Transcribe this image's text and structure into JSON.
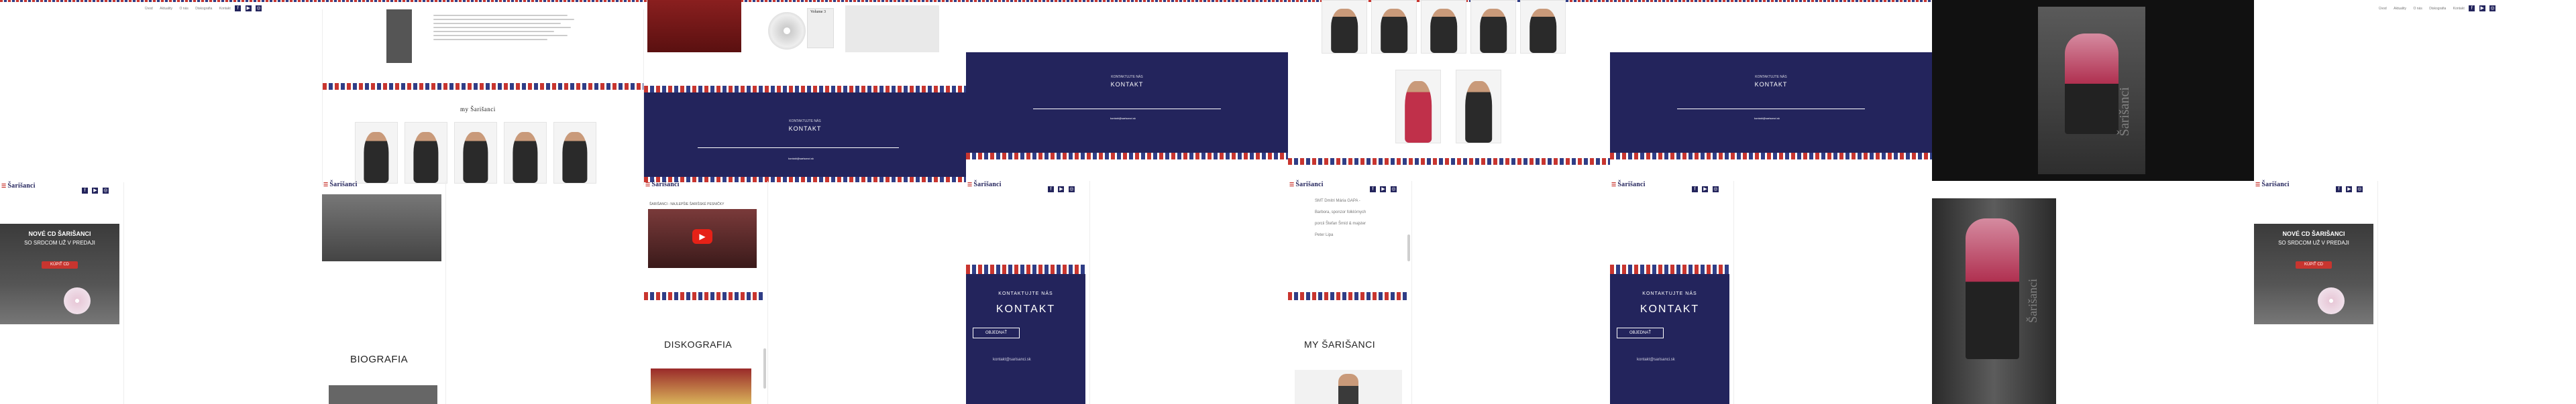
{
  "brand": {
    "logo_text": "Šarišanci",
    "navy": "#23245c",
    "red": "#c8352f"
  },
  "nav": {
    "items": [
      "Úvod",
      "Aktuality",
      "O nás",
      "Diskografia",
      "Kontakt"
    ]
  },
  "social": {
    "icons": [
      "facebook-icon",
      "youtube-icon",
      "instagram-icon",
      "spotify-icon"
    ]
  },
  "about": {
    "heading": "MY ŠARIŠANCI",
    "heading_small": "my Šarišanci"
  },
  "kontakt": {
    "small_title": "KONTAKTUJTE NÁS",
    "title": "KONTAKT",
    "button": "OBJEDNAŤ",
    "email": "kontakt@sarisanci.sk"
  },
  "promo": {
    "line1": "NOVÉ CD ŠARIŠANCI",
    "line2": "SO SRDCOM UŽ V PREDAJI",
    "button": "KÚPIŤ CD"
  },
  "sections": {
    "biografia": "BIOGRAFIA",
    "diskografia": "DISKOGRAFIA",
    "video_caption": "ŠARIŠANCI - NAJLEPŠIE ŠARIŠSKÉ PESNIČKY"
  },
  "album": {
    "label": "Volume 3"
  },
  "bio_text": [
    "SMT Dmitri Mária GAPA -",
    "Barbora, sponzor folklórnych",
    "porcii Štefan Šmíd & majster",
    "Peter Lipa"
  ],
  "watermark": "Šarišanci"
}
